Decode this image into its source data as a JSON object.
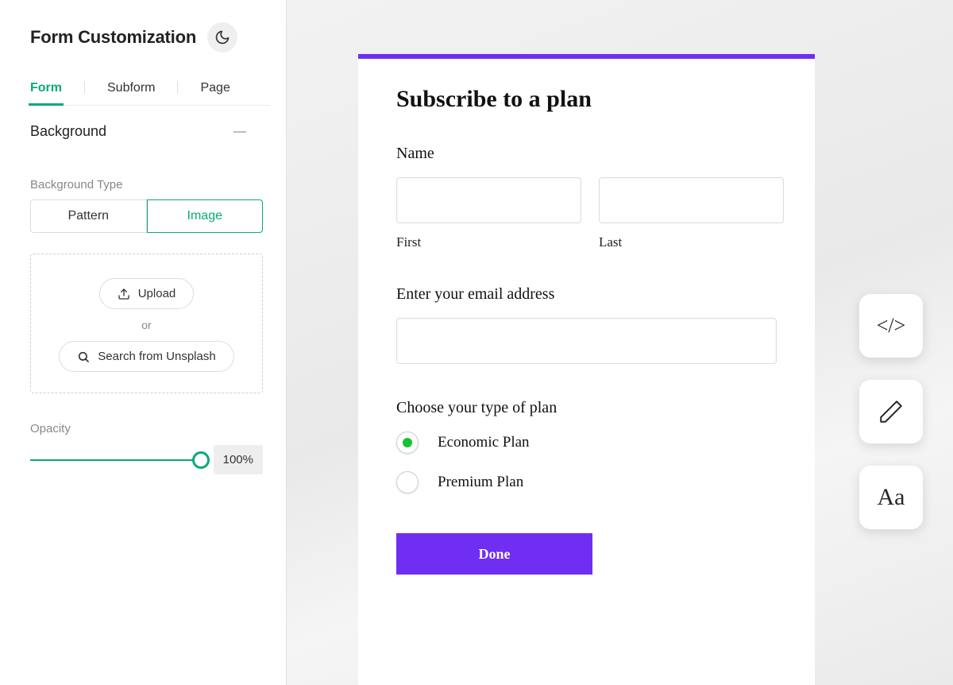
{
  "sidebar": {
    "title": "Form Customization",
    "tabs": [
      "Form",
      "Subform",
      "Page"
    ],
    "active_tab": 0,
    "section": {
      "label": "Background"
    },
    "bg_type": {
      "label": "Background Type",
      "options": [
        "Pattern",
        "Image"
      ],
      "selected": 1
    },
    "upload": {
      "upload_label": "Upload",
      "or_label": "or",
      "search_label": "Search from Unsplash"
    },
    "opacity": {
      "label": "Opacity",
      "value": "100%"
    }
  },
  "form": {
    "title": "Subscribe to a plan",
    "name_label": "Name",
    "first_label": "First",
    "last_label": "Last",
    "email_label": "Enter your email address",
    "plan_label": "Choose your type of plan",
    "plans": [
      {
        "label": "Economic Plan",
        "checked": true
      },
      {
        "label": "Premium Plan",
        "checked": false
      }
    ],
    "submit_label": "Done"
  },
  "colors": {
    "accent_purple": "#6f2ef2",
    "accent_green": "#0aa97a"
  },
  "toolbar": {
    "code_label": "</>",
    "font_label": "Aa"
  }
}
